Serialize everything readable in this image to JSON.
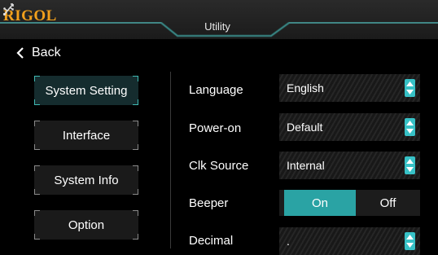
{
  "header": {
    "brand": "RIGOL",
    "title": "Utility",
    "usb_icon": "usb-icon",
    "accent_color": "#2aa3a4",
    "brand_color": "#f2a01c"
  },
  "back": {
    "label": "Back",
    "icon": "chevron-left-icon"
  },
  "nav": [
    {
      "label": "System Setting",
      "active": true
    },
    {
      "label": "Interface",
      "active": false
    },
    {
      "label": "System Info",
      "active": false
    },
    {
      "label": "Option",
      "active": false
    }
  ],
  "settings": {
    "language": {
      "label": "Language",
      "value": "English"
    },
    "power_on": {
      "label": "Power-on",
      "value": "Default"
    },
    "clk_source": {
      "label": "Clk Source",
      "value": "Internal"
    },
    "beeper": {
      "label": "Beeper",
      "on_label": "On",
      "off_label": "Off",
      "selected": "On"
    },
    "decimal": {
      "label": "Decimal",
      "value": "."
    }
  }
}
